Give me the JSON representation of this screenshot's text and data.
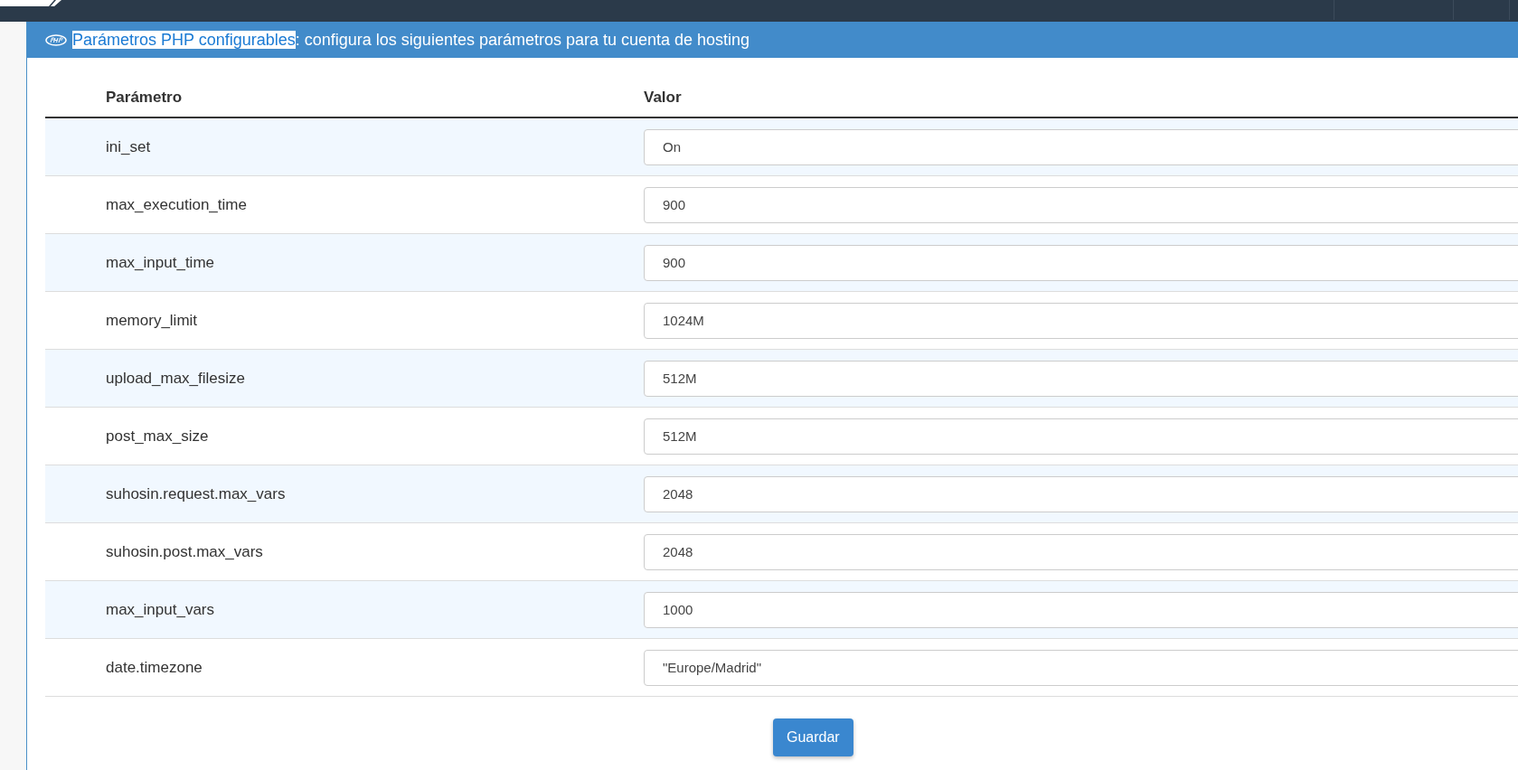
{
  "panel": {
    "title_link": "Parámetros PHP configurables",
    "title_rest": ": configura los siguientes parámetros para tu cuenta de hosting"
  },
  "table": {
    "columns": [
      "Parámetro",
      "Valor"
    ],
    "rows": [
      {
        "name": "ini_set",
        "value": "On"
      },
      {
        "name": "max_execution_time",
        "value": "900"
      },
      {
        "name": "max_input_time",
        "value": "900"
      },
      {
        "name": "memory_limit",
        "value": "1024M"
      },
      {
        "name": "upload_max_filesize",
        "value": "512M"
      },
      {
        "name": "post_max_size",
        "value": "512M"
      },
      {
        "name": "suhosin.request.max_vars",
        "value": "2048"
      },
      {
        "name": "suhosin.post.max_vars",
        "value": "2048"
      },
      {
        "name": "max_input_vars",
        "value": "1000"
      },
      {
        "name": "date.timezone",
        "value": "\"Europe/Madrid\""
      }
    ]
  },
  "save_button": "Guardar"
}
